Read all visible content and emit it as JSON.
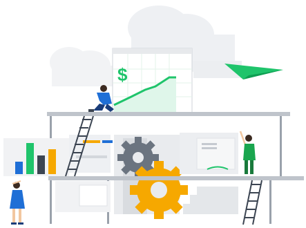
{
  "illustration": {
    "dollar_symbol": "$",
    "colors": {
      "accent_green": "#1fc46b",
      "light_green": "#dff6ea",
      "gear_orange": "#f6a800",
      "gear_gray": "#6b7480",
      "structure_gray": "#9aa1ab",
      "panel_light": "#f1f2f4",
      "bar_blue": "#1f6fd6",
      "bar_dark": "#3c4552",
      "cloud_gray": "#eef0f3",
      "person_blue": "#1f6fd6",
      "person_green": "#1aa64f"
    },
    "bar_chart": {
      "values": [
        2,
        5,
        3,
        4
      ],
      "colors": [
        "#1f6fd6",
        "#1fc46b",
        "#3c4552",
        "#f6a800"
      ]
    },
    "icons": [
      "paper-plane-icon",
      "dollar-sign-icon",
      "gear-icon",
      "ladder-icon",
      "cloud-icon"
    ]
  }
}
